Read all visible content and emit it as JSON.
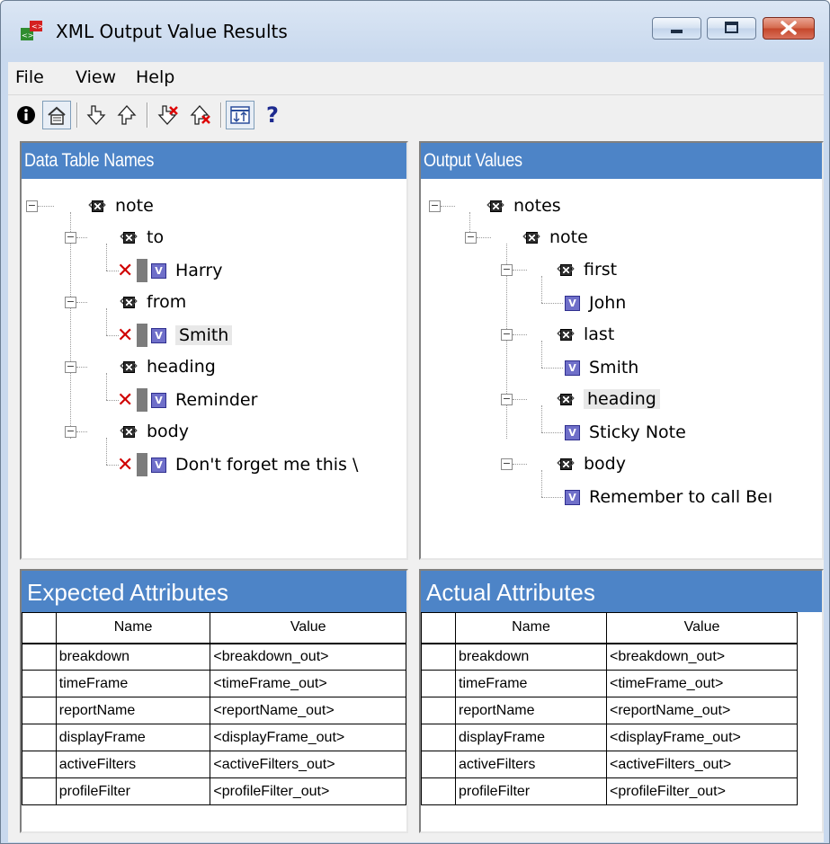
{
  "window": {
    "title": "XML Output Value Results"
  },
  "menu": [
    "File",
    "View",
    "Help"
  ],
  "toolbar": {
    "buttons": [
      "info-icon",
      "properties-icon",
      "next-icon",
      "previous-icon",
      "next-error-icon",
      "previous-error-icon",
      "sort-icon",
      "help-icon"
    ]
  },
  "left_panel": {
    "header": "Data Table Names",
    "root": "note",
    "items": [
      {
        "element": "to",
        "value": "Harry"
      },
      {
        "element": "from",
        "value": "Smith"
      },
      {
        "element": "heading",
        "value": "Reminder"
      },
      {
        "element": "body",
        "value": "Don't forget me this \\"
      }
    ]
  },
  "right_panel": {
    "header": "Output Values",
    "root": "notes",
    "child": "note",
    "items": [
      {
        "element": "first",
        "value": "John"
      },
      {
        "element": "last",
        "value": "Smith"
      },
      {
        "element": "heading",
        "value": "Sticky Note"
      },
      {
        "element": "body",
        "value": "Remember to call Beı"
      }
    ]
  },
  "expected": {
    "header": "Expected Attributes",
    "columns": [
      "Name",
      "Value"
    ],
    "rows": [
      [
        "breakdown",
        "<breakdown_out>"
      ],
      [
        "timeFrame",
        "<timeFrame_out>"
      ],
      [
        "reportName",
        "<reportName_out>"
      ],
      [
        "displayFrame",
        "<displayFrame_out>"
      ],
      [
        "activeFilters",
        "<activeFilters_out>"
      ],
      [
        "profileFilter",
        "<profileFilter_out>"
      ]
    ]
  },
  "actual": {
    "header": "Actual Attributes",
    "columns": [
      "Name",
      "Value"
    ],
    "rows": [
      [
        "breakdown",
        "<breakdown_out>"
      ],
      [
        "timeFrame",
        "<timeFrame_out>"
      ],
      [
        "reportName",
        "<reportName_out>"
      ],
      [
        "displayFrame",
        "<displayFrame_out>"
      ],
      [
        "activeFilters",
        "<activeFilters_out>"
      ],
      [
        "profileFilter",
        "<profileFilter_out>"
      ]
    ]
  }
}
